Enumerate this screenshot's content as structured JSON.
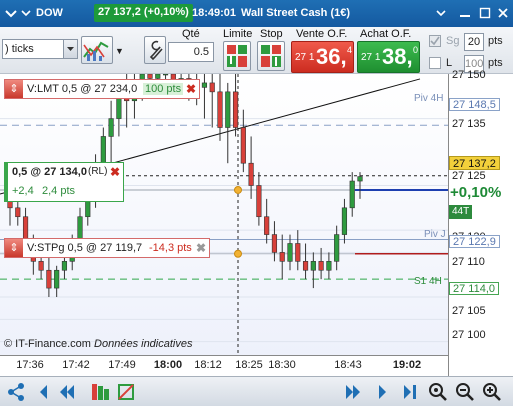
{
  "titlebar": {
    "instrument": "DOW",
    "price_badge": "27 137,2 (+0,10%)",
    "time": "18:49:01",
    "name": "Wall Street Cash (1€)",
    "colors": {
      "bar": "#1f6fb4",
      "badge": "#1d9a3a"
    }
  },
  "toolbar": {
    "ticks_value": ") ticks",
    "qty_label": "Qté",
    "qty_value": "0.5",
    "limit_label": "Limite",
    "stop_label": "Stop",
    "sell_label": "Vente O.F.",
    "buy_label": "Achat O.F.",
    "sell_small": "27 1",
    "sell_big": "36,",
    "sell_sup": "4",
    "buy_small": "27 1",
    "buy_big": "38,",
    "buy_sup": "0",
    "sg_label": "Sg",
    "sg_pts": "20",
    "l_label": "L",
    "l_pts": "100",
    "pts_label": "pts"
  },
  "orders": {
    "limit": {
      "grip": "⇕",
      "text": "V:LMT  0,5 @ 27 234,0",
      "pts": "100 pts",
      "close": "✖"
    },
    "position": {
      "text": "0,5 @ 27 134,0",
      "tag": "(RL)",
      "pnl_pts": "+2,4",
      "pts": "2,4 pts",
      "close": "✖"
    },
    "stop": {
      "grip": "⇕",
      "text": "V:STPg  0,5 @ 27 119,7",
      "pts": "-14,3 pts",
      "close": "✖"
    }
  },
  "chart": {
    "price_labels": [
      "27 150",
      "27 135",
      "27 125",
      "27 120",
      "27 110",
      "27 105",
      "27 100"
    ],
    "levels": {
      "piv4h": {
        "name": "Piv 4H",
        "value": "27 148,5"
      },
      "pivj": {
        "name": "Piv J",
        "value": "27 122,9"
      },
      "s1": {
        "name": "S1 4H",
        "value": "27 114,0"
      }
    },
    "current_price": "27 137,2",
    "variation": "+0,10%",
    "volume": "44T",
    "time_labels": [
      "17:36",
      "17:42",
      "17:49",
      "18:00",
      "18:12",
      "18:25",
      "18:30",
      "18:43",
      "19:02"
    ],
    "copyright": "© IT-Finance.com",
    "copyright_note": "Données indicatives"
  },
  "chart_data": {
    "type": "candlestick",
    "x": [
      "17:36",
      "17:37",
      "17:39",
      "17:40",
      "17:42",
      "17:43",
      "17:45",
      "17:46",
      "17:48",
      "17:49",
      "17:50",
      "17:52",
      "17:53",
      "17:55",
      "17:56",
      "17:58",
      "18:00",
      "18:02",
      "18:04",
      "18:06",
      "18:08",
      "18:10",
      "18:12",
      "18:14",
      "18:16",
      "18:18",
      "18:20",
      "18:22",
      "18:24",
      "18:25",
      "18:26",
      "18:28",
      "18:29",
      "18:30",
      "18:32",
      "18:33",
      "18:35",
      "18:36",
      "18:38",
      "18:39",
      "18:41",
      "18:42",
      "18:43",
      "18:45",
      "18:46",
      "18:47"
    ],
    "candles": [
      {
        "o": 27133,
        "h": 27136,
        "l": 27126,
        "c": 27130
      },
      {
        "o": 27130,
        "h": 27132,
        "l": 27126,
        "c": 27128
      },
      {
        "o": 27128,
        "h": 27130,
        "l": 27120,
        "c": 27122
      },
      {
        "o": 27122,
        "h": 27124,
        "l": 27115,
        "c": 27118
      },
      {
        "o": 27118,
        "h": 27121,
        "l": 27114,
        "c": 27116
      },
      {
        "o": 27116,
        "h": 27119,
        "l": 27110,
        "c": 27112
      },
      {
        "o": 27112,
        "h": 27117,
        "l": 27110,
        "c": 27116
      },
      {
        "o": 27116,
        "h": 27122,
        "l": 27114,
        "c": 27118
      },
      {
        "o": 27118,
        "h": 27124,
        "l": 27116,
        "c": 27122
      },
      {
        "o": 27122,
        "h": 27130,
        "l": 27120,
        "c": 27128
      },
      {
        "o": 27128,
        "h": 27136,
        "l": 27126,
        "c": 27134
      },
      {
        "o": 27134,
        "h": 27142,
        "l": 27130,
        "c": 27140
      },
      {
        "o": 27140,
        "h": 27148,
        "l": 27136,
        "c": 27146
      },
      {
        "o": 27146,
        "h": 27154,
        "l": 27140,
        "c": 27150
      },
      {
        "o": 27150,
        "h": 27158,
        "l": 27146,
        "c": 27156
      },
      {
        "o": 27156,
        "h": 27160,
        "l": 27148,
        "c": 27154
      },
      {
        "o": 27154,
        "h": 27160,
        "l": 27150,
        "c": 27158
      },
      {
        "o": 27158,
        "h": 27161,
        "l": 27154,
        "c": 27160
      },
      {
        "o": 27160,
        "h": 27161,
        "l": 27156,
        "c": 27159
      },
      {
        "o": 27159,
        "h": 27161,
        "l": 27156,
        "c": 27160
      },
      {
        "o": 27160,
        "h": 27161,
        "l": 27157,
        "c": 27160
      },
      {
        "o": 27160,
        "h": 27161,
        "l": 27156,
        "c": 27158
      },
      {
        "o": 27158,
        "h": 27161,
        "l": 27155,
        "c": 27159
      },
      {
        "o": 27159,
        "h": 27161,
        "l": 27154,
        "c": 27158
      },
      {
        "o": 27158,
        "h": 27161,
        "l": 27153,
        "c": 27157
      },
      {
        "o": 27157,
        "h": 27161,
        "l": 27150,
        "c": 27158
      },
      {
        "o": 27158,
        "h": 27161,
        "l": 27148,
        "c": 27156
      },
      {
        "o": 27156,
        "h": 27161,
        "l": 27145,
        "c": 27148
      },
      {
        "o": 27148,
        "h": 27158,
        "l": 27140,
        "c": 27156
      },
      {
        "o": 27156,
        "h": 27160,
        "l": 27146,
        "c": 27148
      },
      {
        "o": 27148,
        "h": 27152,
        "l": 27138,
        "c": 27140
      },
      {
        "o": 27140,
        "h": 27146,
        "l": 27132,
        "c": 27135
      },
      {
        "o": 27135,
        "h": 27138,
        "l": 27126,
        "c": 27128
      },
      {
        "o": 27128,
        "h": 27132,
        "l": 27122,
        "c": 27124
      },
      {
        "o": 27124,
        "h": 27127,
        "l": 27118,
        "c": 27120
      },
      {
        "o": 27120,
        "h": 27124,
        "l": 27114,
        "c": 27118
      },
      {
        "o": 27118,
        "h": 27124,
        "l": 27116,
        "c": 27122
      },
      {
        "o": 27122,
        "h": 27125,
        "l": 27116,
        "c": 27118
      },
      {
        "o": 27118,
        "h": 27122,
        "l": 27114,
        "c": 27116
      },
      {
        "o": 27116,
        "h": 27120,
        "l": 27112,
        "c": 27118
      },
      {
        "o": 27118,
        "h": 27121,
        "l": 27114,
        "c": 27116
      },
      {
        "o": 27116,
        "h": 27120,
        "l": 27114,
        "c": 27118
      },
      {
        "o": 27118,
        "h": 27126,
        "l": 27116,
        "c": 27124
      },
      {
        "o": 27124,
        "h": 27132,
        "l": 27122,
        "c": 27130
      },
      {
        "o": 27130,
        "h": 27138,
        "l": 27128,
        "c": 27136
      },
      {
        "o": 27136,
        "h": 27138,
        "l": 27132,
        "c": 27137
      }
    ],
    "ylim": [
      27097,
      27160
    ],
    "y_ticks": [
      27150,
      27135,
      27125,
      27120,
      27110,
      27105,
      27100
    ],
    "trendline": {
      "from": [
        "17:36",
        27134
      ],
      "to": [
        "18:47",
        27158
      ]
    },
    "levels": [
      {
        "name": "Piv 4H",
        "value": 27148.5,
        "style": "dashed"
      },
      {
        "name": "Piv J",
        "value": 27122.9,
        "style": "solid"
      },
      {
        "name": "S1 4H",
        "value": 27114.0,
        "style": "dashed-green"
      },
      {
        "name": "V:LMT",
        "value": 27234.0
      },
      {
        "name": "position",
        "value": 27134.0
      },
      {
        "name": "V:STPg",
        "value": 27119.7
      }
    ],
    "current": 27137.2,
    "colors": {
      "up": "#2e9b3f",
      "down": "#d8403a",
      "trend": "#111111",
      "s1": "#2fa84a",
      "piv": "#8aa0c6"
    }
  }
}
